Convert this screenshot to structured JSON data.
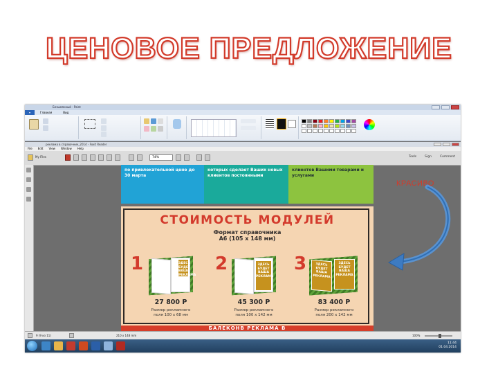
{
  "slide": {
    "title": "ЦЕНОВОЕ ПРЕДЛОЖЕНИЕ",
    "annotation": "КРАСИВО"
  },
  "paint": {
    "window_title": "Безымянный - Paint",
    "tabs": [
      "Главная",
      "Вид"
    ]
  },
  "reader": {
    "window_title": "реклама в справочник_2014 - Foxit Reader",
    "menu": [
      "File",
      "Edit",
      "View",
      "Window",
      "Help"
    ],
    "my_files": "My Files",
    "zoom": "74%",
    "tools": [
      "Tools",
      "Sign",
      "Comment"
    ],
    "page_indicator": "9 (9 из 11)",
    "page_size": "210 x 148 mm",
    "zoom_status": "100%"
  },
  "document": {
    "col1_text": "по привлекательной цене до 30 марта",
    "col2_text": "которых сделает Ваших новых клиентов постоянными",
    "col3_text": "клиентов Вашими товарами и услугами",
    "heading": "СТОИМОСТЬ МОДУЛЕЙ",
    "format_line1": "Формат справочника",
    "format_line2": "А6 (105 х 148 мм)",
    "ad_text": "ЗДЕСЬ БУДЕТ ВАША РЕКЛАМА",
    "bottom_banner": "БАЛЕКОНВ РЕКЛАМА В",
    "options": [
      {
        "num": "1",
        "price": "27 800 Р",
        "desc1": "Размер рекламного",
        "desc2": "поля 100 х 68 мм"
      },
      {
        "num": "2",
        "price": "45 300 Р",
        "desc1": "Размер рекламного",
        "desc2": "поля 100 х 142 мм"
      },
      {
        "num": "3",
        "price": "83 400 Р",
        "desc1": "Размер рекламного",
        "desc2": "поля 200 х 142 мм"
      }
    ]
  },
  "taskbar": {
    "time": "11:44",
    "date": "01.04.2014"
  },
  "colors": {
    "title_red": "#d23a2a",
    "blue_col": "#21a3d6",
    "teal_col": "#1aaa9b",
    "green_col": "#8dc33f",
    "orange_bg": "#f5d5b2"
  }
}
